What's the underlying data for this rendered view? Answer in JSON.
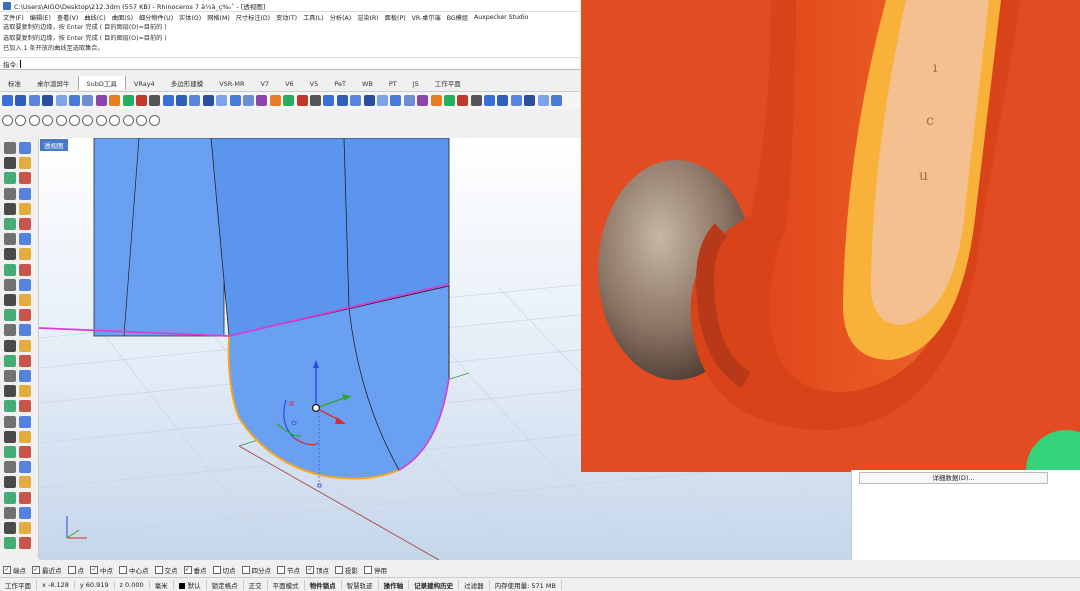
{
  "window": {
    "title": "C:\\Users\\AIGO\\Desktop\\212.3dm (557 KB) - Rhinoceros 7 ä¼ä¸ç‰ˆ - [透视图]"
  },
  "menu": [
    "文件(F)",
    "编辑(E)",
    "查看(V)",
    "曲线(C)",
    "曲面(S)",
    "细分物件(U)",
    "实体(O)",
    "网格(M)",
    "尺寸标注(D)",
    "变动(T)",
    "工具(L)",
    "分析(A)",
    "渲染(R)",
    "面板(P)",
    "VR-桌尔端",
    "BG模组",
    "Auxpecker Studio"
  ],
  "command": {
    "history": [
      "选取要复制的边缘，按 Enter 完成 ( 目的图层(O)=目前的 )",
      "选取要复制的边缘，按 Enter 完成 ( 目的图层(O)=目前的 )",
      "已加入 1 条开放的曲线至选取集合。"
    ],
    "prompt": "指令:"
  },
  "tabs": [
    {
      "label": "标准",
      "active": false
    },
    {
      "label": "桌尔渲屏牛",
      "active": false
    },
    {
      "label": "SubD工具",
      "active": true
    },
    {
      "label": "VRay4",
      "active": false
    },
    {
      "label": "多边形建模",
      "active": false
    },
    {
      "label": "VSR-MR",
      "active": false
    },
    {
      "label": "V7",
      "active": false
    },
    {
      "label": "V6",
      "active": false
    },
    {
      "label": "V5",
      "active": false
    },
    {
      "label": "PeT",
      "active": false
    },
    {
      "label": "WB",
      "active": false
    },
    {
      "label": "PT",
      "active": false
    },
    {
      "label": "JS",
      "active": false
    },
    {
      "label": "工作平面",
      "active": false
    }
  ],
  "viewport": {
    "label": "透视图",
    "colors": {
      "surface": "#6aa0f2",
      "border": "#d63fd6",
      "edge": "#f5a623",
      "grid": "#c9d3de"
    }
  },
  "right_panel": {
    "detail_button": "详细数据(D)..."
  },
  "osnaps": [
    {
      "label": "端点",
      "checked": true
    },
    {
      "label": "最近点",
      "checked": true
    },
    {
      "label": "点",
      "checked": false
    },
    {
      "label": "中点",
      "checked": true
    },
    {
      "label": "中心点",
      "checked": false
    },
    {
      "label": "交点",
      "checked": false
    },
    {
      "label": "垂点",
      "checked": true
    },
    {
      "label": "切点",
      "checked": false
    },
    {
      "label": "四分点",
      "checked": false
    },
    {
      "label": "节点",
      "checked": false
    },
    {
      "label": "顶点",
      "checked": true
    },
    {
      "label": "投影",
      "checked": false
    },
    {
      "label": "停用",
      "checked": false
    }
  ],
  "status": {
    "cplane": "工作平面",
    "x": "x -8.128",
    "y": "y 60.919",
    "z": "z 0.000",
    "unit": "毫米",
    "layer": "默认",
    "items": [
      {
        "label": "锁定格点",
        "bold": false
      },
      {
        "label": "正交",
        "bold": false
      },
      {
        "label": "平面模式",
        "bold": false
      },
      {
        "label": "物件锁点",
        "bold": true
      },
      {
        "label": "智慧轨迹",
        "bold": false
      },
      {
        "label": "操作轴",
        "bold": true
      },
      {
        "label": "记录建构历史",
        "bold": true
      },
      {
        "label": "过滤器",
        "bold": false
      }
    ],
    "memory": "内存使用量: 571 MB"
  }
}
